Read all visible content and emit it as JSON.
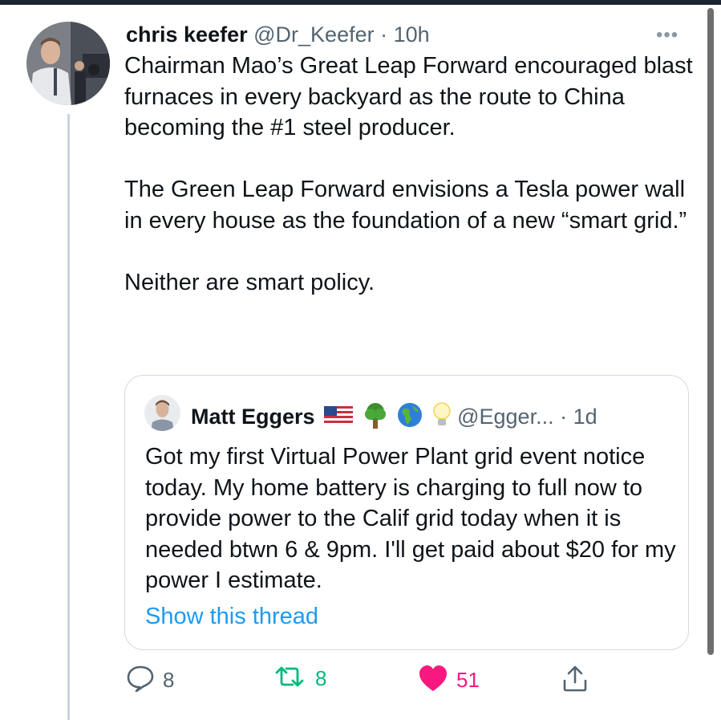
{
  "tweet": {
    "author_name": "chris keefer",
    "meta": "@Dr_Keefer · 10h",
    "more_label": "•••",
    "text": "Chairman Mao’s Great Leap Forward encouraged blast furnaces in every backyard as the route to China becoming the #1 steel producer.\n\nThe Green Leap Forward envisions a Tesla power wall in every house as the foundation of a new “smart grid.”\n\nNeither are smart policy."
  },
  "quote": {
    "author_name": "Matt Eggers",
    "emojis": [
      "us-flag",
      "tree",
      "globe-americas",
      "light-bulb"
    ],
    "meta": "@Egger... · 1d",
    "text": "Got my first Virtual Power Plant grid event notice today. My home battery is charging to full now to provide power to the Calif grid today when it is needed btwn 6 & 9pm. I'll get paid about $20 for my power I estimate.",
    "show_thread_label": "Show this thread"
  },
  "actions": {
    "reply_count": "8",
    "retweet_count": "8",
    "like_count": "51",
    "icons": [
      "reply-icon",
      "retweet-icon",
      "like-icon",
      "share-icon"
    ]
  },
  "colors": {
    "link": "#1d9bf0",
    "retweet": "#00ba7c",
    "like": "#f91880",
    "secondary_text": "#536471"
  }
}
